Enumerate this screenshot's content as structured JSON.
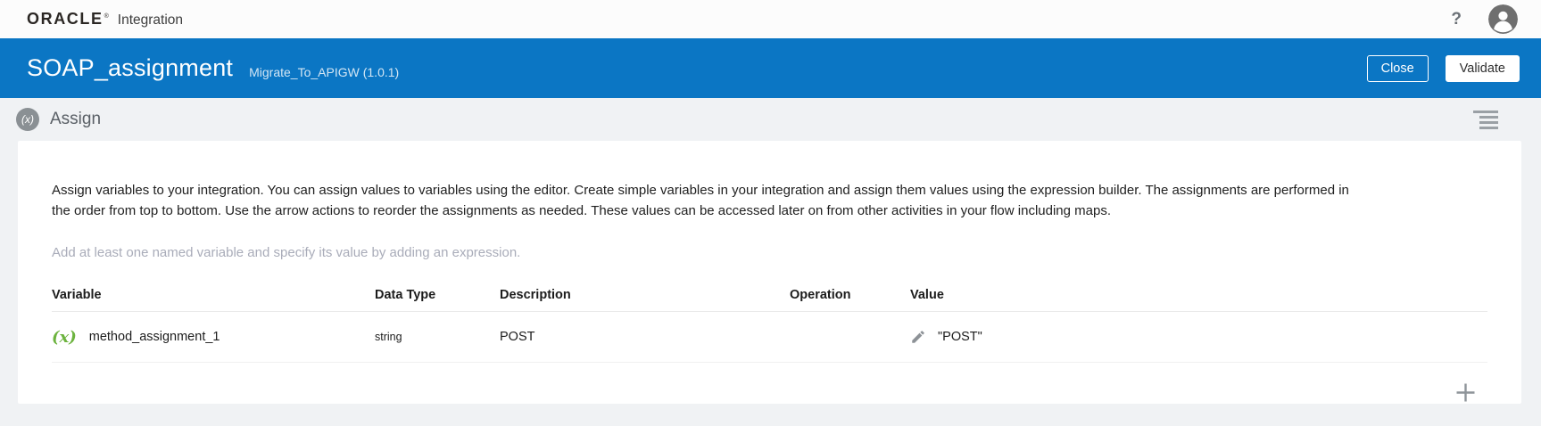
{
  "topbar": {
    "logo": "ORACLE",
    "trademark": "®",
    "product": "Integration",
    "help_label": "?"
  },
  "header": {
    "title": "SOAP_assignment",
    "subtitle": "Migrate_To_APIGW (1.0.1)",
    "buttons": {
      "close": "Close",
      "validate": "Validate"
    }
  },
  "section": {
    "icon_text": "(x)",
    "title": "Assign"
  },
  "main": {
    "description": "Assign variables to your integration. You can assign values to variables using the editor. Create simple variables in your integration and assign them values using the expression builder. The assignments are performed in the order from top to bottom. Use the arrow actions to reorder the assignments as needed. These values can be accessed later on from other activities in your flow including maps.",
    "hint": "Add at least one named variable and specify its value by adding an expression.",
    "table": {
      "columns": {
        "variable": "Variable",
        "data_type": "Data Type",
        "description": "Description",
        "operation": "Operation",
        "value": "Value"
      },
      "rows": [
        {
          "icon": "(x)",
          "variable": "method_assignment_1",
          "data_type": "string",
          "description": "POST",
          "operation": "",
          "value": "\"POST\""
        }
      ]
    }
  },
  "colors": {
    "header_blue": "#0b76c4",
    "fx_green": "#6cb33e",
    "hint_gray": "#a9acb9",
    "page_bg": "#f0f2f4"
  }
}
